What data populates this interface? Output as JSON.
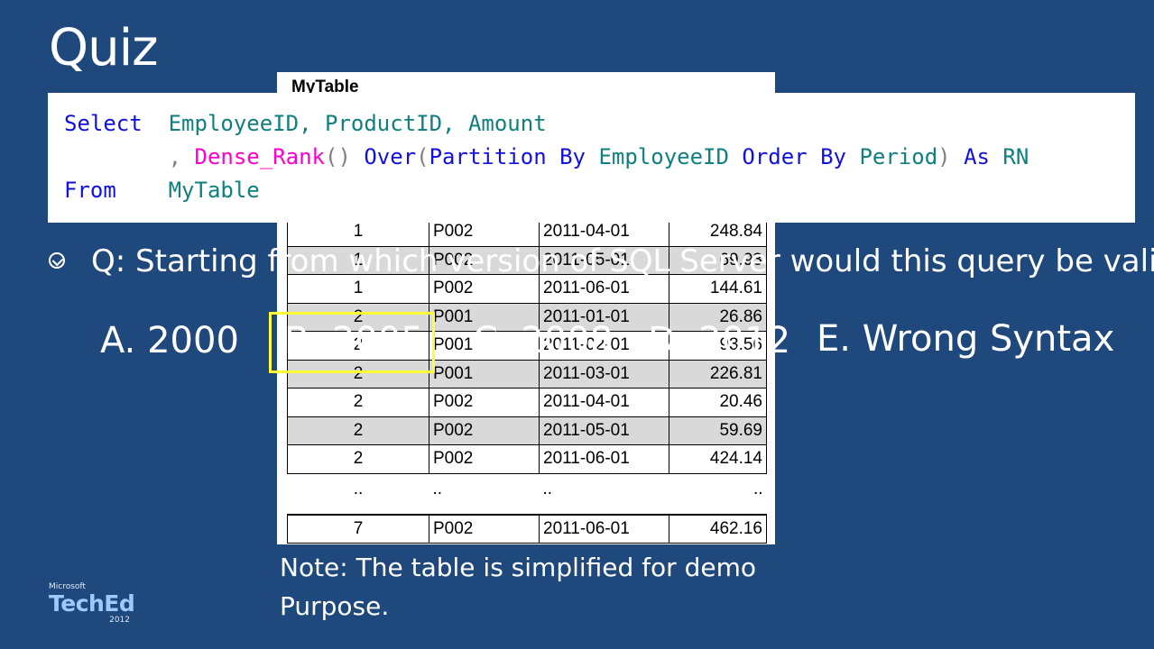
{
  "slide": {
    "title": "Quiz"
  },
  "table": {
    "caption": "MyTable",
    "rows": [
      {
        "emp": "1",
        "prod": "P002",
        "period": "2011-04-01",
        "amount": "248.84",
        "shaded": false
      },
      {
        "emp": "1",
        "prod": "P002",
        "period": "2011-05-01",
        "amount": "69.93",
        "shaded": true
      },
      {
        "emp": "1",
        "prod": "P002",
        "period": "2011-06-01",
        "amount": "144.61",
        "shaded": false
      },
      {
        "emp": "2",
        "prod": "P001",
        "period": "2011-01-01",
        "amount": "26.86",
        "shaded": true
      },
      {
        "emp": "2",
        "prod": "P001",
        "period": "2011-02-01",
        "amount": "93.56",
        "shaded": false
      },
      {
        "emp": "2",
        "prod": "P001",
        "period": "2011-03-01",
        "amount": "226.81",
        "shaded": true
      },
      {
        "emp": "2",
        "prod": "P002",
        "period": "2011-04-01",
        "amount": "20.46",
        "shaded": false
      },
      {
        "emp": "2",
        "prod": "P002",
        "period": "2011-05-01",
        "amount": "59.69",
        "shaded": true
      },
      {
        "emp": "2",
        "prod": "P002",
        "period": "2011-06-01",
        "amount": "424.14",
        "shaded": false
      }
    ],
    "ellipsis": "..",
    "last_row": {
      "emp": "7",
      "prod": "P002",
      "period": "2011-06-01",
      "amount": "462.16"
    }
  },
  "code": {
    "select_kw": "Select",
    "cols": "EmployeeID, ProductID, Amount",
    "comma": ",",
    "fn": "Dense_Rank",
    "parens": "()",
    "over_kw": "Over",
    "lparen": "(",
    "partition_kw": "Partition By",
    "partition_col": "EmployeeID",
    "order_kw": "Order By",
    "order_col": "Period",
    "rparen": ")",
    "as_kw": "As",
    "alias": "RN",
    "from_kw": "From",
    "table": "MyTable"
  },
  "question": "Q: Starting from which version of SQL Server would this query be valid",
  "answers": {
    "a": "A. 2000",
    "b": "B. 2005",
    "c": "C. 2008",
    "d": "D. 2012",
    "e": "E. Wrong Syntax"
  },
  "highlighted_answer": "b",
  "note": "Note: The table is simplified for demo Purpose.",
  "brand": {
    "company": "Microsoft",
    "product": "TechEd",
    "year": "2012"
  },
  "colors": {
    "background": "#1f497d",
    "keyword": "#1111dd",
    "identifier": "#0f7f7f",
    "function": "#ff00cc",
    "operator": "#808080",
    "highlight": "#ffff33",
    "row_shade": "#d9d9d9"
  }
}
